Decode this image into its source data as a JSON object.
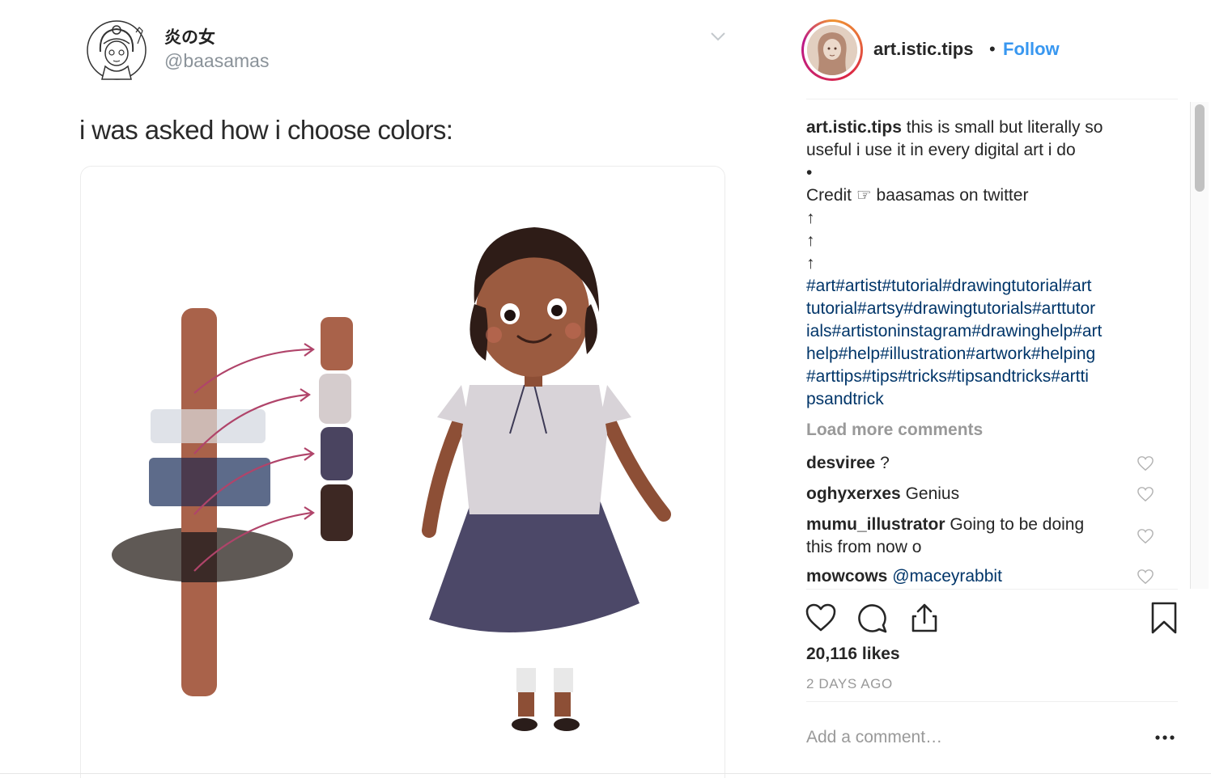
{
  "tweet": {
    "name": "炎の女",
    "handle": "@baasamas",
    "text": "i was asked how i choose colors:"
  },
  "post": {
    "username": "art.istic.tips",
    "separator": "•",
    "follow_label": "Follow",
    "caption": {
      "username": "art.istic.tips",
      "lines": [
        "this is small but literally so",
        "useful i use it in every digital art i do",
        "•",
        "Credit ☞ baasamas on twitter",
        "↑",
        "↑",
        "↑"
      ],
      "hashtag_lines": [
        "#art#artist#tutorial#drawingtutorial#art",
        "tutorial#artsy#drawingtutorials#arttutor",
        "ials#artistoninstagram#drawinghelp#art",
        "help#help#illustration#artwork#helping",
        "#arttips#tips#tricks#tipsandtricks#artti",
        "psandtrick"
      ]
    },
    "load_more": "Load more comments",
    "comments": [
      {
        "user": "desviree",
        "text": "?",
        "mention": ""
      },
      {
        "user": "oghyxerxes",
        "text": "Genius",
        "mention": ""
      },
      {
        "user": "mumu_illustrator",
        "text": "Going to be doing",
        "text2": "this from now o",
        "mention": ""
      },
      {
        "user": "mowcows",
        "text": "",
        "mention": "@maceyrabbit"
      }
    ],
    "likes": "20,116 likes",
    "time_ago": "2 DAYS AGO",
    "add_comment_placeholder": "Add a comment…"
  },
  "colors": {
    "follow": "#3897f0",
    "hashtag": "#003569",
    "muted": "#999999",
    "text": "#262626"
  },
  "icons": [
    "chevron-down-icon",
    "heart-icon",
    "comment-icon",
    "share-icon",
    "bookmark-icon",
    "more-icon"
  ]
}
